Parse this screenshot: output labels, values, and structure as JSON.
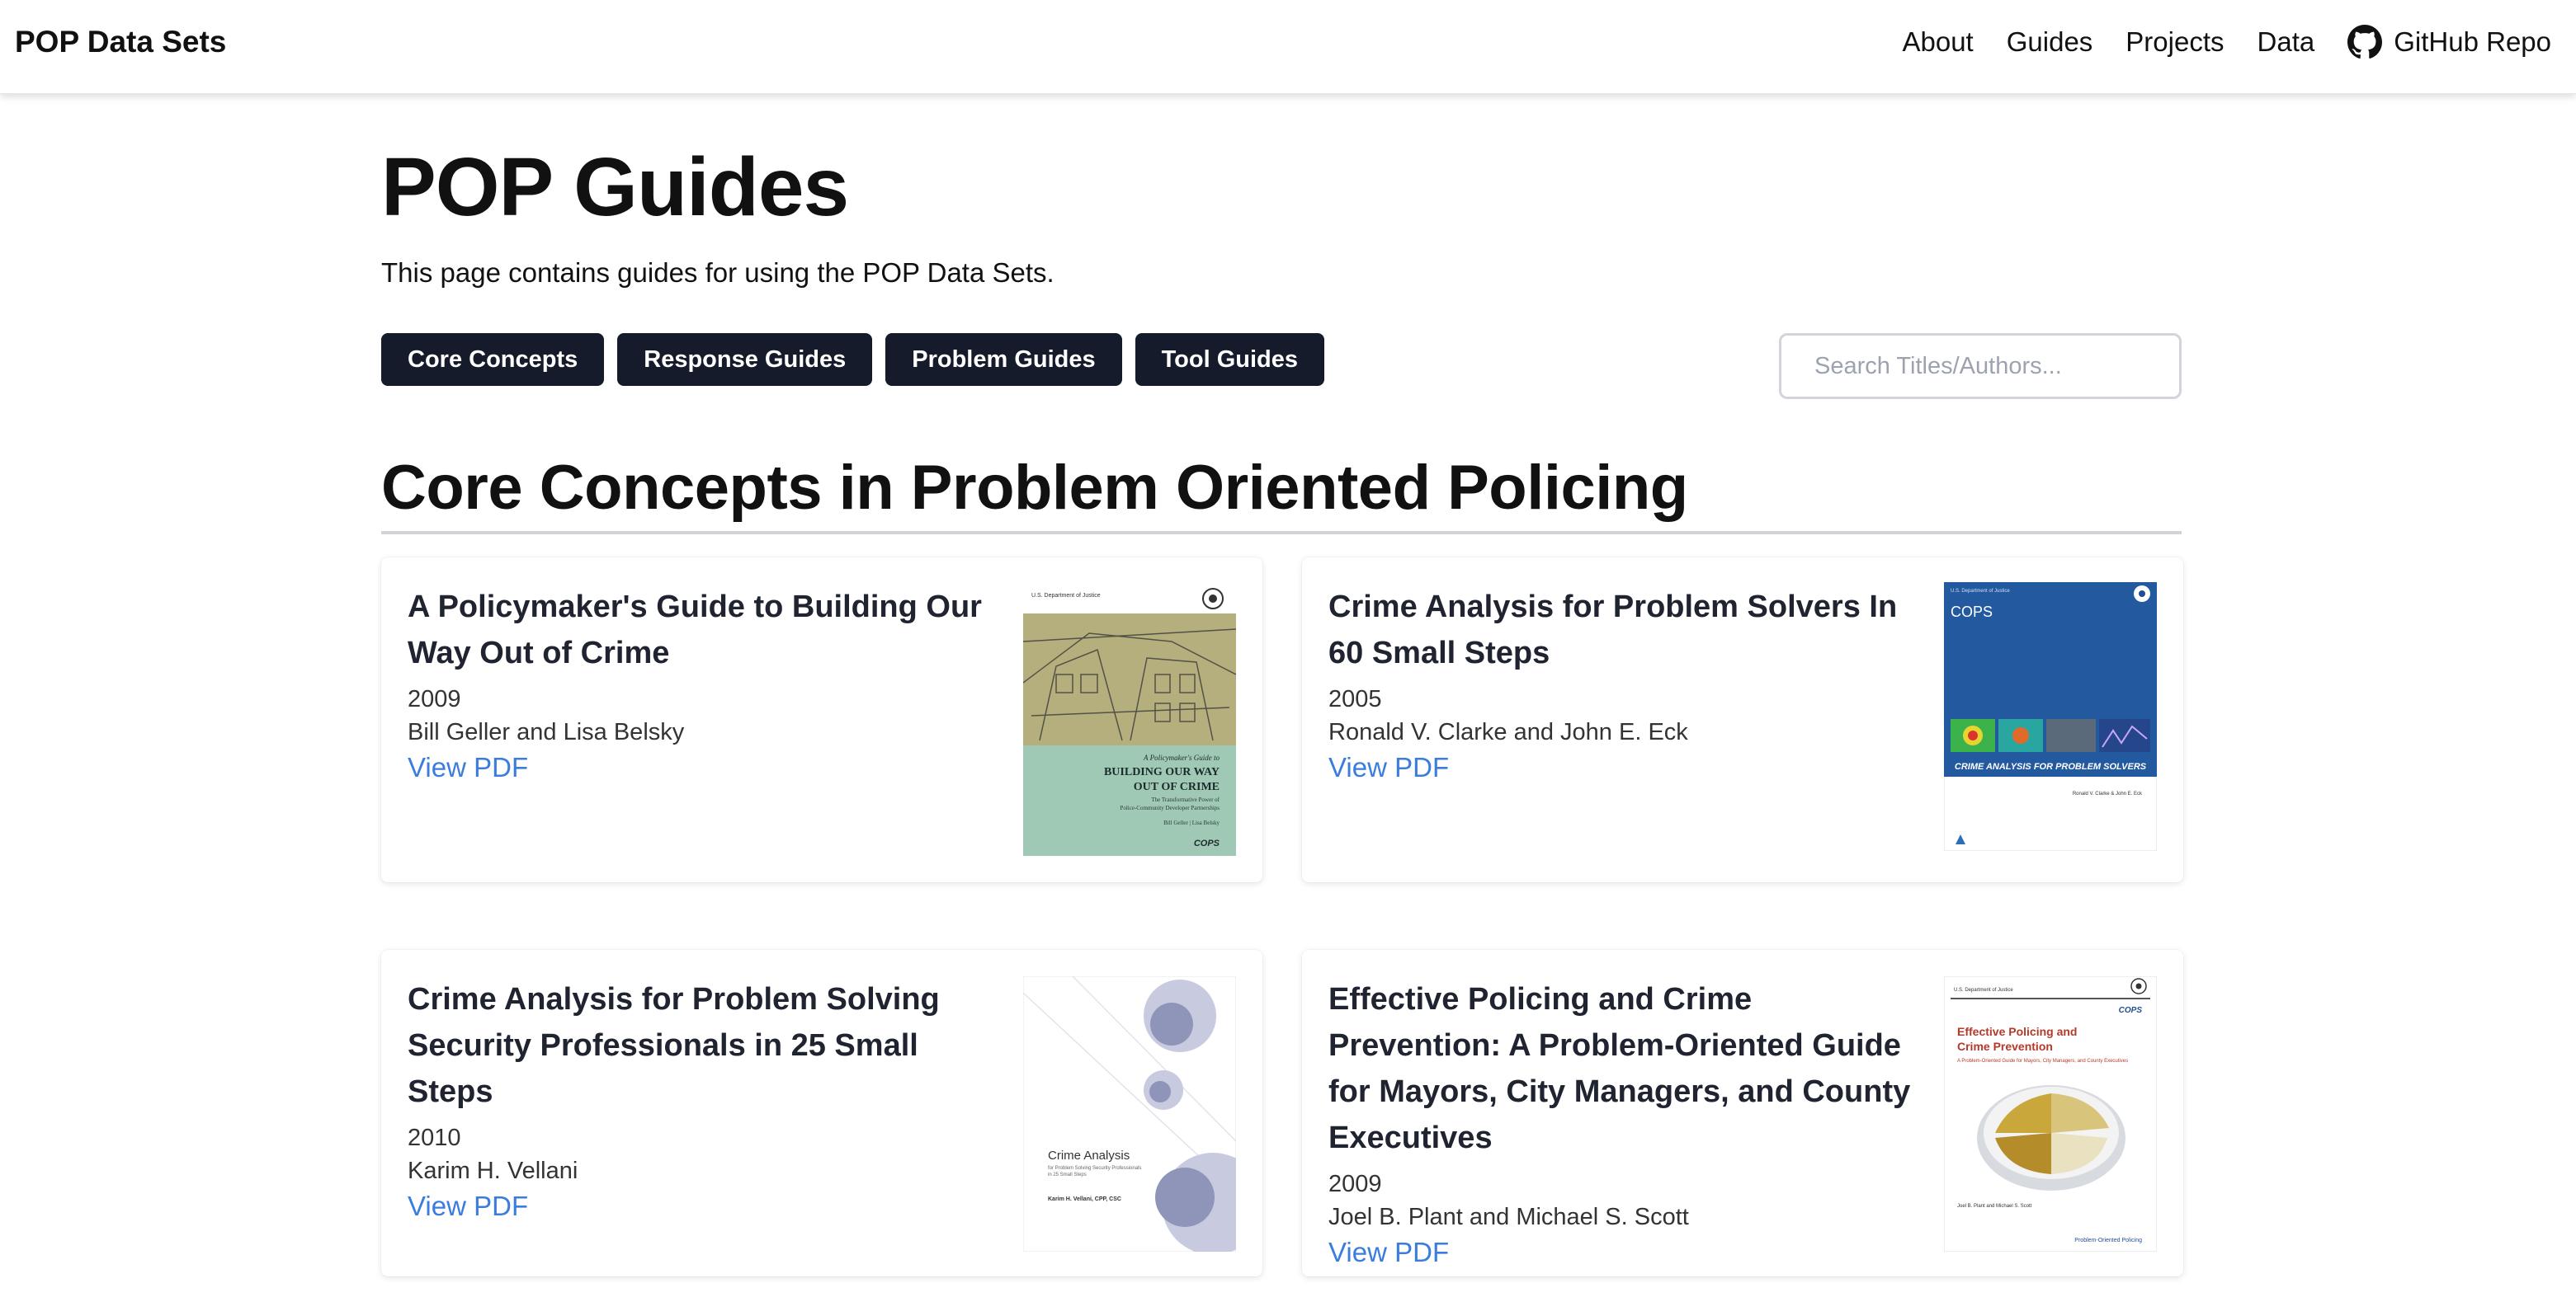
{
  "nav": {
    "brand": "POP Data Sets",
    "links": [
      "About",
      "Guides",
      "Projects",
      "Data",
      "GitHub Repo"
    ]
  },
  "header": {
    "title": "POP Guides",
    "description": "This page contains guides for using the POP Data Sets."
  },
  "filters": [
    "Core Concepts",
    "Response Guides",
    "Problem Guides",
    "Tool Guides"
  ],
  "search": {
    "placeholder": "Search Titles/Authors...",
    "value": ""
  },
  "section": {
    "title": "Core Concepts in Problem Oriented Policing"
  },
  "cards": [
    {
      "title": "A Policymaker's Guide to Building Our Way Out of Crime",
      "year": "2009",
      "authors": "Bill Geller and Lisa Belsky",
      "link": "View PDF",
      "cover": {
        "header_line": "U.S. Department of Justice",
        "title_small": "A Policymaker's Guide to",
        "title_big": "BUILDING OUR WAY OUT OF CRIME",
        "subtitle": "The Transformative Power of Police-Community Developer Partnerships",
        "authors": "Bill Geller | Lisa Belsky",
        "logo": "COPS",
        "color": "#9fc9b5"
      }
    },
    {
      "title": "Crime Analysis for Problem Solvers In 60 Small Steps",
      "year": "2005",
      "authors": "Ronald V. Clarke and John E. Eck",
      "link": "View PDF",
      "cover": {
        "header_line": "U.S. Department of Justice",
        "logo": "COPS",
        "title_big": "CRIME ANALYSIS FOR PROBLEM SOLVERS",
        "authors": "Ronald V. Clarke & John E. Eck",
        "color": "#1f4e93"
      }
    },
    {
      "title": "Crime Analysis for Problem Solving Security Professionals in 25 Small Steps",
      "year": "2010",
      "authors": "Karim H. Vellani",
      "link": "View PDF",
      "cover": {
        "title_big": "Crime Analysis",
        "subtitle": "for Problem Solving Security Professionals in 25 Small Steps",
        "authors": "Karim H. Vellani, CPP, CSC",
        "color": "#8f95b8"
      }
    },
    {
      "title": "Effective Policing and Crime Prevention: A Problem-Oriented Guide for Mayors, City Managers, and County Executives",
      "year": "2009",
      "authors": "Joel B. Plant and Michael S. Scott",
      "link": "View PDF",
      "cover": {
        "header_line": "U.S. Department of Justice",
        "logo": "COPS",
        "title_big": "Effective Policing and Crime Prevention",
        "subtitle": "A Problem-Oriented Guide for Mayors, City Managers, and County Executives",
        "authors": "Joel B. Plant and Michael S. Scott",
        "footer": "Problem-Oriented Policing",
        "color": "#b33a2a"
      }
    }
  ],
  "icons": {
    "github": "github-icon",
    "seal": "doj-seal-icon"
  },
  "colors": {
    "button_bg": "#151b2a",
    "link": "#3b7ddd",
    "rule": "#d0d4d8"
  }
}
